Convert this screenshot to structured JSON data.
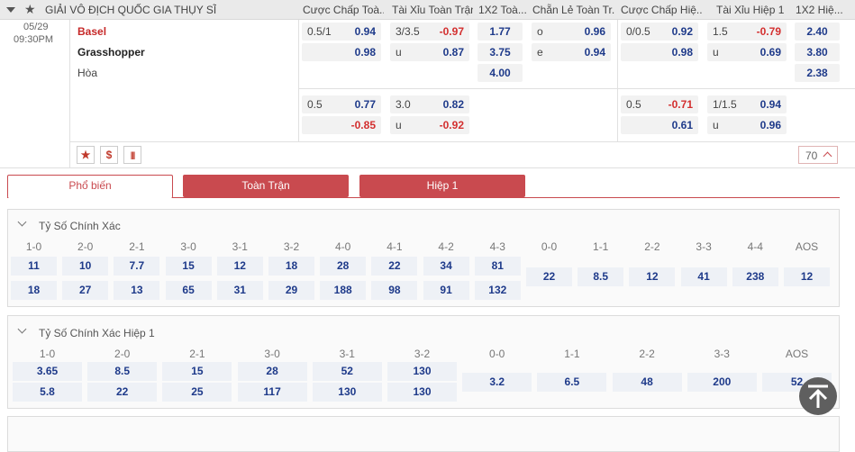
{
  "header": {
    "league": "GIẢI VÔ ĐỊCH QUỐC GIA THỤY SĨ",
    "cols": [
      "Cược Chấp Toà...",
      "Tài Xỉu Toàn Trận",
      "1X2 Toà...",
      "Chẵn Lẻ Toàn Tr...",
      "Cược Chấp Hiệ...",
      "Tài Xỉu Hiệp 1",
      "1X2 Hiệ..."
    ]
  },
  "match": {
    "date": "05/29",
    "time": "09:30PM",
    "home": "Basel",
    "away": "Grasshopper",
    "draw": "Hòa",
    "more_count": "70"
  },
  "odds": {
    "r1": {
      "hcap_line": "0.5/1",
      "hcap_home": "0.94",
      "hcap_away": "0.98",
      "ou_line": "3/3.5",
      "ou_over": "-0.97",
      "ou_under_lbl": "u",
      "ou_under": "0.87",
      "x12_home": "1.77",
      "x12_away": "3.75",
      "x12_draw": "4.00",
      "oe_o_lbl": "o",
      "oe_o": "0.96",
      "oe_e_lbl": "e",
      "oe_e": "0.94",
      "h1_hcap_line": "0/0.5",
      "h1_hcap_home": "0.92",
      "h1_hcap_away": "0.98",
      "h1_ou_line": "1.5",
      "h1_ou_over": "-0.79",
      "h1_ou_under_lbl": "u",
      "h1_ou_under": "0.69",
      "h1_x12_home": "2.40",
      "h1_x12_away": "3.80",
      "h1_x12_draw": "2.38"
    },
    "r2": {
      "hcap_line": "0.5",
      "hcap_home": "0.77",
      "hcap_away": "-0.85",
      "ou_line": "3.0",
      "ou_over": "0.82",
      "ou_under_lbl": "u",
      "ou_under": "-0.92",
      "h1_hcap_line": "0.5",
      "h1_hcap_home": "-0.71",
      "h1_hcap_away": "0.61",
      "h1_ou_line": "1/1.5",
      "h1_ou_over": "0.94",
      "h1_ou_under_lbl": "u",
      "h1_ou_under": "0.96"
    }
  },
  "icons": {
    "fav": "★",
    "money": "$",
    "stats": "|||"
  },
  "tabs": [
    "Phổ biến",
    "Toàn Trận",
    "Hiệp 1"
  ],
  "correct_score": {
    "title": "Tỷ Số Chính Xác",
    "headers": [
      "1-0",
      "2-0",
      "2-1",
      "3-0",
      "3-1",
      "3-2",
      "4-0",
      "4-1",
      "4-2",
      "4-3",
      "0-0",
      "1-1",
      "2-2",
      "3-3",
      "4-4",
      "AOS"
    ],
    "home": [
      "11",
      "10",
      "7.7",
      "15",
      "12",
      "18",
      "28",
      "22",
      "34",
      "81"
    ],
    "away": [
      "18",
      "27",
      "13",
      "65",
      "31",
      "29",
      "188",
      "98",
      "91",
      "132"
    ],
    "draws": [
      "22",
      "8.5",
      "12",
      "41",
      "238",
      "12"
    ]
  },
  "correct_score_h1": {
    "title": "Tỷ Số Chính Xác Hiệp 1",
    "headers": [
      "1-0",
      "2-0",
      "2-1",
      "3-0",
      "3-1",
      "3-2",
      "0-0",
      "1-1",
      "2-2",
      "3-3",
      "AOS"
    ],
    "home": [
      "3.65",
      "8.5",
      "15",
      "28",
      "52",
      "130"
    ],
    "away": [
      "5.8",
      "22",
      "25",
      "117",
      "130",
      "130"
    ],
    "draws": [
      "3.2",
      "6.5",
      "48",
      "200",
      "52"
    ]
  },
  "colors": {
    "accent": "#c94a4f",
    "odds_blue": "#1e3a8a",
    "odds_red": "#d32f2f"
  }
}
